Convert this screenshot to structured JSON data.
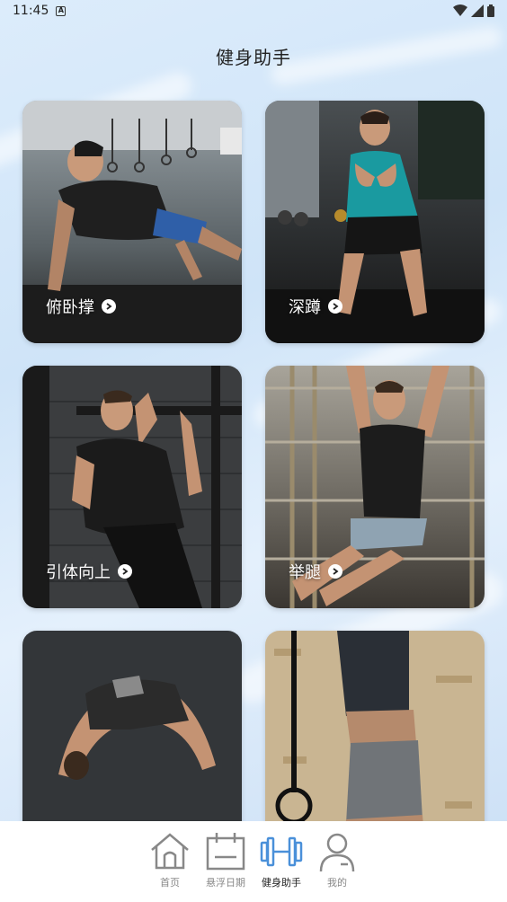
{
  "status_bar": {
    "time": "11:45"
  },
  "header": {
    "title": "健身助手"
  },
  "cards": [
    {
      "label": "俯卧撑"
    },
    {
      "label": "深蹲"
    },
    {
      "label": "引体向上"
    },
    {
      "label": "举腿"
    },
    {
      "label": ""
    },
    {
      "label": ""
    }
  ],
  "bottom_nav": {
    "items": [
      {
        "label": "首页",
        "icon": "home-icon"
      },
      {
        "label": "悬浮日期",
        "icon": "calendar-icon"
      },
      {
        "label": "健身助手",
        "icon": "dumbbell-icon",
        "active": true
      },
      {
        "label": "我的",
        "icon": "user-icon"
      }
    ]
  },
  "colors": {
    "accent": "#4a90d9",
    "icon_inactive": "#888888"
  }
}
